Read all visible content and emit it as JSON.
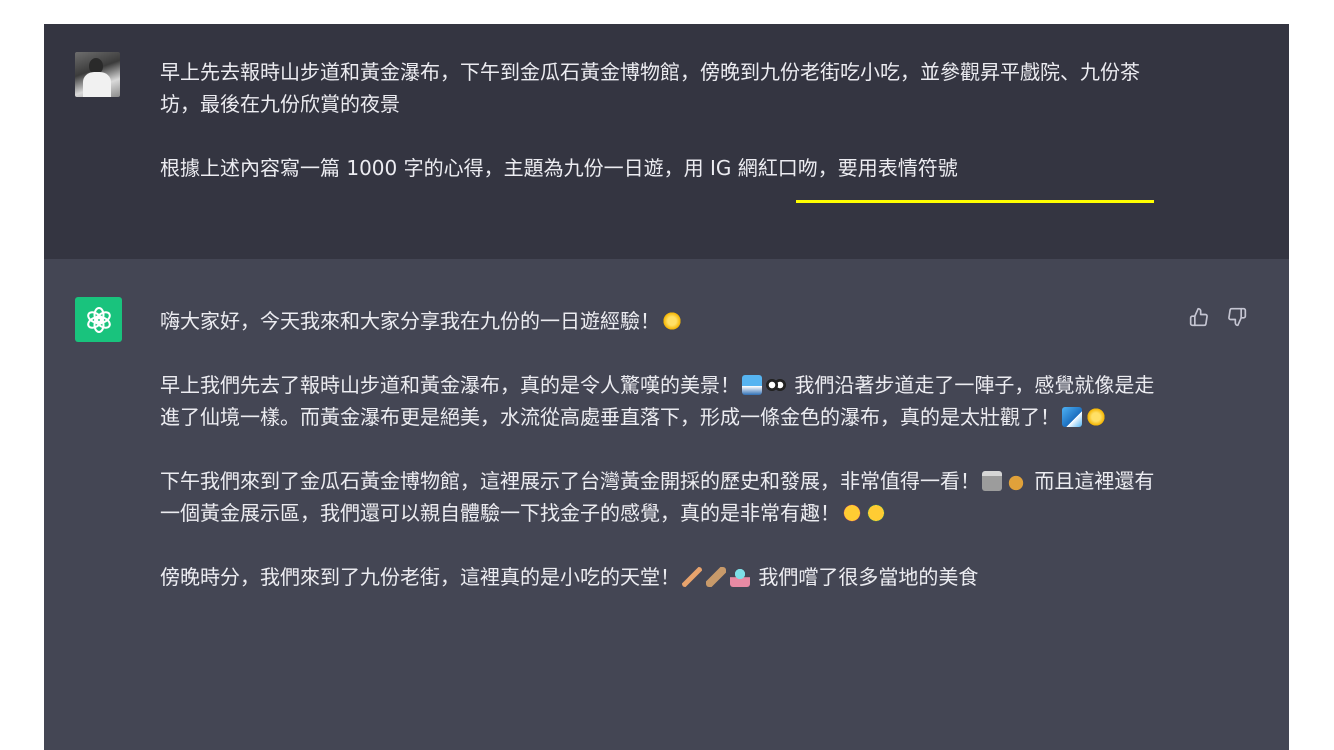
{
  "user_message": {
    "paragraph_1": "早上先去報時山步道和黃金瀑布，下午到金瓜石黃金博物館，傍晚到九份老街吃小吃，並參觀昇平戲院、九份茶坊，最後在九份欣賞的夜景",
    "paragraph_2_plain": "根據上述內容寫一篇 1000 字的心得，主題為九份一日遊，",
    "paragraph_2_highlight": "用 IG 網紅口吻，要用表情符號",
    "highlight_color": "#ffff00"
  },
  "assistant_message": {
    "p1_text": "嗨大家好，今天我來和大家分享我在九份的一日遊經驗！",
    "p2_text_a": "早上我們先去了報時山步道和黃金瀑布，真的是令人驚嘆的美景！",
    "p2_text_b": " 我們沿著步道走了一陣子，感覺就像是走進了仙境一樣。而黃金瀑布更是絕美，水流從高處垂直落下，形成一條金色的瀑布，真的是太壯觀了！",
    "p3_text_a": "下午我們來到了金瓜石黃金博物館，這裡展示了台灣黃金開採的歷史和發展，非常值得一看！",
    "p3_text_b": " 而且這裡還有一個黃金展示區，我們還可以親自體驗一下找金子的感覺，真的是非常有趣！",
    "p4_text_a": "傍晚時分，我們來到了九份老街，這裡真的是小吃的天堂！",
    "p4_text_b": " 我們嚐了很多當地的美食"
  },
  "icons": {
    "user_avatar": "user-photo-avatar",
    "assistant_avatar": "openai-logo-icon",
    "thumbs_up": "thumbs-up-icon",
    "thumbs_down": "thumbs-down-icon"
  },
  "colors": {
    "user_bg": "#343541",
    "assistant_bg": "#444654",
    "text": "#ececf1",
    "bot_avatar_bg": "#19c37d"
  }
}
